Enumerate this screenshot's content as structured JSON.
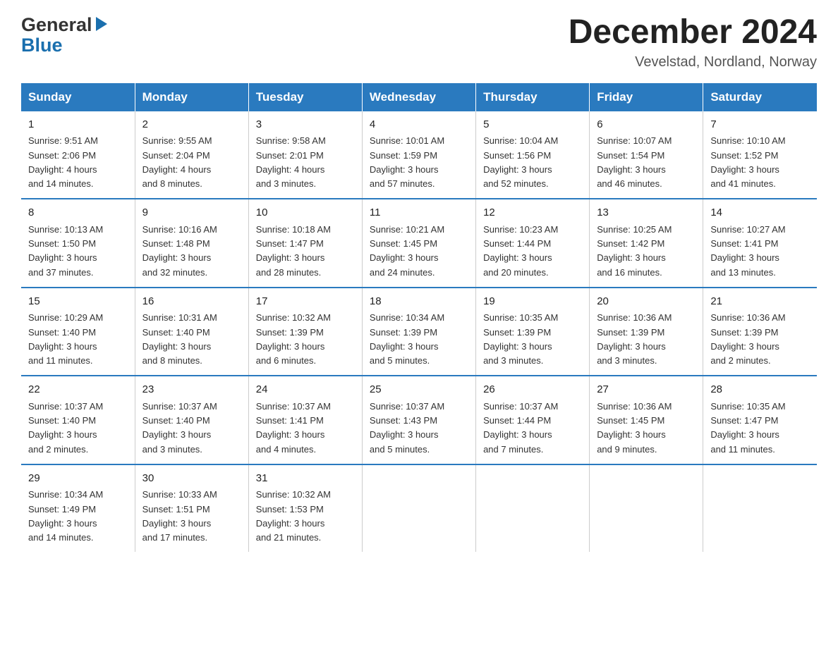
{
  "logo": {
    "general": "General",
    "blue": "Blue"
  },
  "title": "December 2024",
  "subtitle": "Vevelstad, Nordland, Norway",
  "days_of_week": [
    "Sunday",
    "Monday",
    "Tuesday",
    "Wednesday",
    "Thursday",
    "Friday",
    "Saturday"
  ],
  "weeks": [
    [
      {
        "num": "1",
        "sunrise": "Sunrise: 9:51 AM",
        "sunset": "Sunset: 2:06 PM",
        "daylight": "Daylight: 4 hours",
        "daylight2": "and 14 minutes."
      },
      {
        "num": "2",
        "sunrise": "Sunrise: 9:55 AM",
        "sunset": "Sunset: 2:04 PM",
        "daylight": "Daylight: 4 hours",
        "daylight2": "and 8 minutes."
      },
      {
        "num": "3",
        "sunrise": "Sunrise: 9:58 AM",
        "sunset": "Sunset: 2:01 PM",
        "daylight": "Daylight: 4 hours",
        "daylight2": "and 3 minutes."
      },
      {
        "num": "4",
        "sunrise": "Sunrise: 10:01 AM",
        "sunset": "Sunset: 1:59 PM",
        "daylight": "Daylight: 3 hours",
        "daylight2": "and 57 minutes."
      },
      {
        "num": "5",
        "sunrise": "Sunrise: 10:04 AM",
        "sunset": "Sunset: 1:56 PM",
        "daylight": "Daylight: 3 hours",
        "daylight2": "and 52 minutes."
      },
      {
        "num": "6",
        "sunrise": "Sunrise: 10:07 AM",
        "sunset": "Sunset: 1:54 PM",
        "daylight": "Daylight: 3 hours",
        "daylight2": "and 46 minutes."
      },
      {
        "num": "7",
        "sunrise": "Sunrise: 10:10 AM",
        "sunset": "Sunset: 1:52 PM",
        "daylight": "Daylight: 3 hours",
        "daylight2": "and 41 minutes."
      }
    ],
    [
      {
        "num": "8",
        "sunrise": "Sunrise: 10:13 AM",
        "sunset": "Sunset: 1:50 PM",
        "daylight": "Daylight: 3 hours",
        "daylight2": "and 37 minutes."
      },
      {
        "num": "9",
        "sunrise": "Sunrise: 10:16 AM",
        "sunset": "Sunset: 1:48 PM",
        "daylight": "Daylight: 3 hours",
        "daylight2": "and 32 minutes."
      },
      {
        "num": "10",
        "sunrise": "Sunrise: 10:18 AM",
        "sunset": "Sunset: 1:47 PM",
        "daylight": "Daylight: 3 hours",
        "daylight2": "and 28 minutes."
      },
      {
        "num": "11",
        "sunrise": "Sunrise: 10:21 AM",
        "sunset": "Sunset: 1:45 PM",
        "daylight": "Daylight: 3 hours",
        "daylight2": "and 24 minutes."
      },
      {
        "num": "12",
        "sunrise": "Sunrise: 10:23 AM",
        "sunset": "Sunset: 1:44 PM",
        "daylight": "Daylight: 3 hours",
        "daylight2": "and 20 minutes."
      },
      {
        "num": "13",
        "sunrise": "Sunrise: 10:25 AM",
        "sunset": "Sunset: 1:42 PM",
        "daylight": "Daylight: 3 hours",
        "daylight2": "and 16 minutes."
      },
      {
        "num": "14",
        "sunrise": "Sunrise: 10:27 AM",
        "sunset": "Sunset: 1:41 PM",
        "daylight": "Daylight: 3 hours",
        "daylight2": "and 13 minutes."
      }
    ],
    [
      {
        "num": "15",
        "sunrise": "Sunrise: 10:29 AM",
        "sunset": "Sunset: 1:40 PM",
        "daylight": "Daylight: 3 hours",
        "daylight2": "and 11 minutes."
      },
      {
        "num": "16",
        "sunrise": "Sunrise: 10:31 AM",
        "sunset": "Sunset: 1:40 PM",
        "daylight": "Daylight: 3 hours",
        "daylight2": "and 8 minutes."
      },
      {
        "num": "17",
        "sunrise": "Sunrise: 10:32 AM",
        "sunset": "Sunset: 1:39 PM",
        "daylight": "Daylight: 3 hours",
        "daylight2": "and 6 minutes."
      },
      {
        "num": "18",
        "sunrise": "Sunrise: 10:34 AM",
        "sunset": "Sunset: 1:39 PM",
        "daylight": "Daylight: 3 hours",
        "daylight2": "and 5 minutes."
      },
      {
        "num": "19",
        "sunrise": "Sunrise: 10:35 AM",
        "sunset": "Sunset: 1:39 PM",
        "daylight": "Daylight: 3 hours",
        "daylight2": "and 3 minutes."
      },
      {
        "num": "20",
        "sunrise": "Sunrise: 10:36 AM",
        "sunset": "Sunset: 1:39 PM",
        "daylight": "Daylight: 3 hours",
        "daylight2": "and 3 minutes."
      },
      {
        "num": "21",
        "sunrise": "Sunrise: 10:36 AM",
        "sunset": "Sunset: 1:39 PM",
        "daylight": "Daylight: 3 hours",
        "daylight2": "and 2 minutes."
      }
    ],
    [
      {
        "num": "22",
        "sunrise": "Sunrise: 10:37 AM",
        "sunset": "Sunset: 1:40 PM",
        "daylight": "Daylight: 3 hours",
        "daylight2": "and 2 minutes."
      },
      {
        "num": "23",
        "sunrise": "Sunrise: 10:37 AM",
        "sunset": "Sunset: 1:40 PM",
        "daylight": "Daylight: 3 hours",
        "daylight2": "and 3 minutes."
      },
      {
        "num": "24",
        "sunrise": "Sunrise: 10:37 AM",
        "sunset": "Sunset: 1:41 PM",
        "daylight": "Daylight: 3 hours",
        "daylight2": "and 4 minutes."
      },
      {
        "num": "25",
        "sunrise": "Sunrise: 10:37 AM",
        "sunset": "Sunset: 1:43 PM",
        "daylight": "Daylight: 3 hours",
        "daylight2": "and 5 minutes."
      },
      {
        "num": "26",
        "sunrise": "Sunrise: 10:37 AM",
        "sunset": "Sunset: 1:44 PM",
        "daylight": "Daylight: 3 hours",
        "daylight2": "and 7 minutes."
      },
      {
        "num": "27",
        "sunrise": "Sunrise: 10:36 AM",
        "sunset": "Sunset: 1:45 PM",
        "daylight": "Daylight: 3 hours",
        "daylight2": "and 9 minutes."
      },
      {
        "num": "28",
        "sunrise": "Sunrise: 10:35 AM",
        "sunset": "Sunset: 1:47 PM",
        "daylight": "Daylight: 3 hours",
        "daylight2": "and 11 minutes."
      }
    ],
    [
      {
        "num": "29",
        "sunrise": "Sunrise: 10:34 AM",
        "sunset": "Sunset: 1:49 PM",
        "daylight": "Daylight: 3 hours",
        "daylight2": "and 14 minutes."
      },
      {
        "num": "30",
        "sunrise": "Sunrise: 10:33 AM",
        "sunset": "Sunset: 1:51 PM",
        "daylight": "Daylight: 3 hours",
        "daylight2": "and 17 minutes."
      },
      {
        "num": "31",
        "sunrise": "Sunrise: 10:32 AM",
        "sunset": "Sunset: 1:53 PM",
        "daylight": "Daylight: 3 hours",
        "daylight2": "and 21 minutes."
      },
      null,
      null,
      null,
      null
    ]
  ]
}
